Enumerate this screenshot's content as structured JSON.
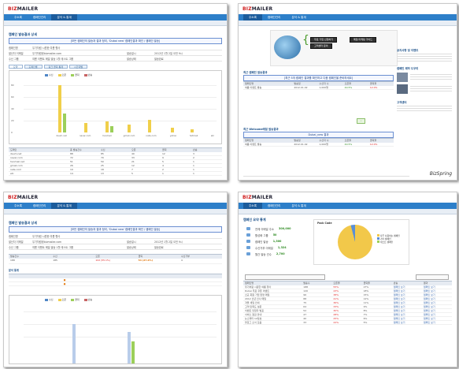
{
  "brand": {
    "logo_a": "BIZ",
    "logo_b": "MAILER"
  },
  "nav": {
    "tabs": [
      "주소록",
      "캠페인관리",
      "분석 & 통계"
    ],
    "tabs_s2": [
      "주소록",
      "캠페인관리",
      "분석 & 통계"
    ]
  },
  "s1": {
    "title": "캠페인 발송결과 상세",
    "banner": "[모든 캠페인의 발송과 결과 정리, 'Dubai new' 캠페인결과 확인 / 캠페인 발송]",
    "fields": [
      {
        "label": "캠페인명",
        "value": "우기처럼 시원한 여름 행사"
      },
      {
        "label": "발신자 이메일",
        "value": "우기처럼@bizmailer.com",
        "label2": "발송일시",
        "value2": "2012년 1월 2일 오전 9시"
      },
      {
        "label": "수신 그룹",
        "value": "여름 이벤트 메일 발송 1월 테스트 그룹",
        "label2": "발송상태",
        "value2": "발송완료"
      }
    ],
    "tabs": [
      "요약",
      "도메인별",
      "링크 클릭 통계",
      "시간대별"
    ],
    "legend": [
      "수신",
      "오픈",
      "클릭",
      "반송"
    ],
    "yticks": [
      "80",
      "60",
      "40",
      "20",
      "0"
    ],
    "xcats": [
      "daum.net",
      "naver.com",
      "hanmail",
      "gmail.com",
      "nate.com",
      "yahoo",
      "hotmail",
      "etc"
    ],
    "table_head": [
      "도메인",
      "총 발송건수",
      "수신",
      "오픈",
      "클릭",
      "반송"
    ],
    "table_rows": [
      [
        "daum.net",
        "88",
        "85",
        "40",
        "12",
        "3"
      ],
      [
        "naver.com",
        "72",
        "70",
        "33",
        "9",
        "2"
      ],
      [
        "hanmail.net",
        "51",
        "50",
        "21",
        "5",
        "1"
      ],
      [
        "gmail.com",
        "26",
        "25",
        "12",
        "4",
        "1"
      ],
      [
        "nate.com",
        "19",
        "18",
        "7",
        "2",
        "1"
      ],
      [
        "etc",
        "14",
        "13",
        "5",
        "1",
        "1"
      ]
    ]
  },
  "s2": {
    "promo_buttons": [
      "무료 가입 신청하기",
      "메일 마케팅 가이드",
      "고객센터 문의"
    ],
    "section1": "최근 캠페인 발송결과",
    "banner": "[최근 5개 캠페인 결과를 확인하고 다음 캠페인을 준비하세요]",
    "row1": [
      "캠페인명",
      "발송일",
      "수신자 수",
      "오픈율",
      "클릭율"
    ],
    "row1_vals": [
      "여름 이벤트 발송",
      "2012.01.02",
      "1,000명",
      "40.5%",
      "12.0%"
    ],
    "section2": "최근 Welcome메일 발송결과",
    "banner2": "Dubai_new 결과",
    "side_title": "공지사항 및 이벤트",
    "side_title2": "캠페인 제작 도우미",
    "side_title3": "고객센터",
    "footer_brand": "BizSpring"
  },
  "s3": {
    "title": "캠페인 발송결과 상세",
    "banner": "[모든 캠페인의 발송과 결과 정리, 'Dubai new' 캠페인결과 확인 / 캠페인 발송]",
    "summary_head": [
      "발송건수",
      "수신",
      "오픈",
      "클릭",
      "수신거부"
    ],
    "summary_vals": [
      "188",
      "185",
      "102 (55.1%)",
      "54 (27.0%)",
      "4"
    ],
    "section": "분석 통계",
    "legend": [
      "수신",
      "오픈",
      "클릭",
      "반송"
    ]
  },
  "s4": {
    "title": "캠페인 요약 통계",
    "stats": [
      {
        "label": "전체 이메일 주소",
        "value": "300,000"
      },
      {
        "label": "활성화 그룹",
        "value": "50"
      },
      {
        "label": "캠페인 발송",
        "value": "1,300"
      },
      {
        "label": "수신거부 이메일",
        "value": "1,324"
      },
      {
        "label": "월간 발송 건수",
        "value": "2,700"
      }
    ],
    "pie_title": "Pack Code",
    "pie_legend": [
      "자주 사용하는 캠페인",
      "기타 캠페인",
      "테스트 캠페인"
    ],
    "list_head": [
      "캠페인명",
      "발송수",
      "오픈율",
      "클릭율",
      "반송",
      "결과"
    ],
    "list_rows": [
      "우기처럼 시원한 여름 행사",
      "Dubai 무료 쿠폰 이벤트",
      "신규 회원 가입 환영 메일",
      "2012 신년 인사 메일",
      "겨울 세일 안내",
      "고객 만족도 설문",
      "이벤트 당첨자 발표",
      "서비스 점검 안내",
      "뉴스레터 12월호",
      "블로그 소식 모음"
    ],
    "action": "캠페인 보기"
  }
}
